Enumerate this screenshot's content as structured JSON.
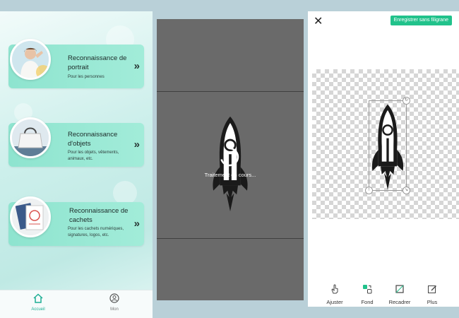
{
  "colors": {
    "card_bg": "#9ce9d6",
    "accent_green": "#21c28b",
    "processing_bg": "#6a6a6a",
    "tab_active": "#1fae94"
  },
  "panel1": {
    "cards": [
      {
        "title": "Reconnaissance de portrait",
        "subtitle": "Pour les personnes",
        "icon": "portrait-thumbnail"
      },
      {
        "title": "Reconnaissance d'objets",
        "subtitle": "Pour les objets, vêtements, animaux, etc.",
        "icon": "handbag-thumbnail"
      },
      {
        "title": "Reconnaissance de cachets",
        "subtitle": "Pour les cachets numériques, signatures, logos, etc.",
        "icon": "stamp-thumbnail"
      }
    ],
    "chevron": "»",
    "tabs": [
      {
        "label": "Accueil",
        "icon": "home-icon",
        "active": true
      },
      {
        "label": "Mon",
        "icon": "profile-icon",
        "active": false
      }
    ]
  },
  "panel2": {
    "status": "Traitement en cours...",
    "icon": "loading-spinner-icon"
  },
  "panel3": {
    "close_icon": "✕",
    "save_button": "Enregistrer sans filigrane",
    "tools": [
      {
        "label": "Ajuster",
        "icon": "hand-icon"
      },
      {
        "label": "Fond",
        "icon": "background-icon"
      },
      {
        "label": "Recadrer",
        "icon": "crop-icon"
      },
      {
        "label": "Plus",
        "icon": "edit-icon"
      }
    ]
  }
}
